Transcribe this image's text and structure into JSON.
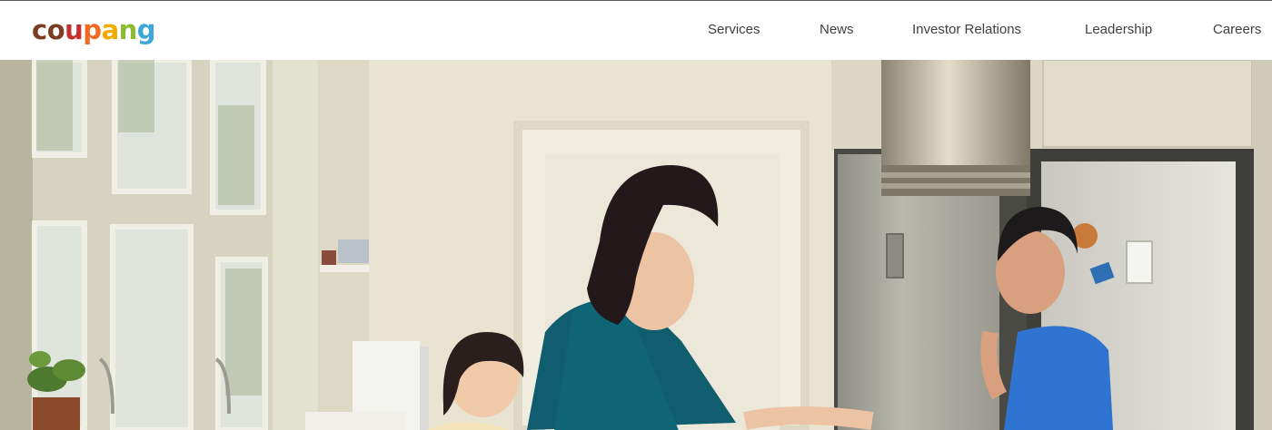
{
  "logo": {
    "letters": [
      {
        "char": "c",
        "color": "#7a3d21"
      },
      {
        "char": "o",
        "color": "#7a3d21"
      },
      {
        "char": "u",
        "color": "#c42e2e"
      },
      {
        "char": "p",
        "color": "#f26a21"
      },
      {
        "char": "a",
        "color": "#f2a900"
      },
      {
        "char": "n",
        "color": "#8cbb33"
      },
      {
        "char": "g",
        "color": "#3ea7d9"
      }
    ]
  },
  "nav": {
    "services": "Services",
    "news": "News",
    "investor_relations": "Investor Relations",
    "leadership": "Leadership",
    "careers": "Careers"
  },
  "colors": {
    "nav_text": "#3f3f3f",
    "header_bg": "#ffffff"
  },
  "hero": {
    "image": "family-in-kitchen-photo"
  }
}
